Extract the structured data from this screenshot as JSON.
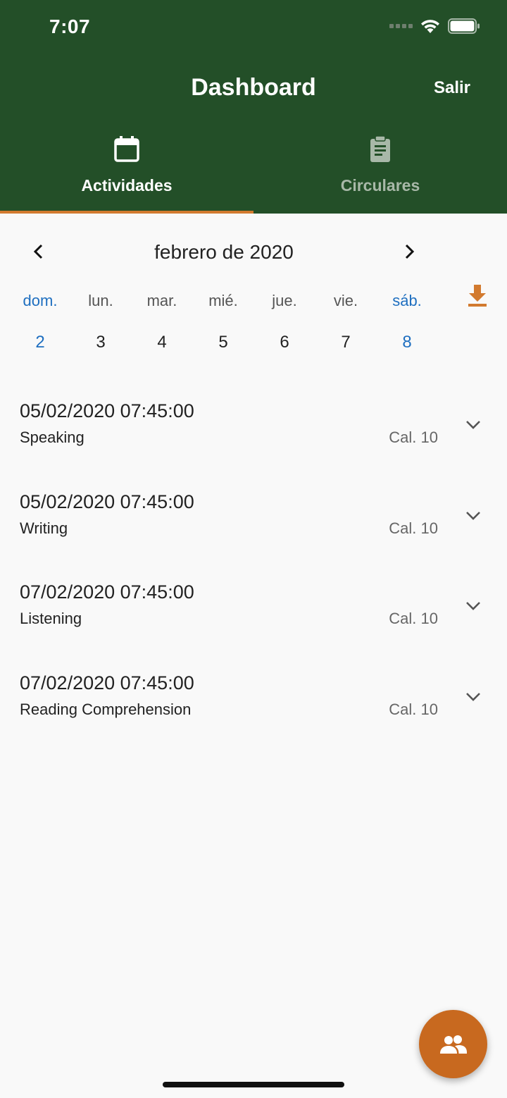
{
  "status_bar": {
    "time": "7:07"
  },
  "header": {
    "title": "Dashboard",
    "exit_label": "Salir"
  },
  "tabs": [
    {
      "label": "Actividades",
      "icon": "calendar-icon",
      "active": true
    },
    {
      "label": "Circulares",
      "icon": "clipboard-icon",
      "active": false
    }
  ],
  "calendar": {
    "month_label": "febrero de 2020",
    "weekdays": [
      "dom.",
      "lun.",
      "mar.",
      "mié.",
      "jue.",
      "vie.",
      "sáb."
    ],
    "dates": [
      "2",
      "3",
      "4",
      "5",
      "6",
      "7",
      "8"
    ]
  },
  "activities": [
    {
      "datetime": "05/02/2020 07:45:00",
      "subject": "Speaking",
      "grade": "Cal. 10"
    },
    {
      "datetime": "05/02/2020 07:45:00",
      "subject": "Writing",
      "grade": "Cal. 10"
    },
    {
      "datetime": "07/02/2020 07:45:00",
      "subject": "Listening",
      "grade": "Cal. 10"
    },
    {
      "datetime": "07/02/2020 07:45:00",
      "subject": "Reading Comprehension",
      "grade": "Cal. 10"
    }
  ],
  "colors": {
    "header_bg": "#234f28",
    "accent": "#d27a2f",
    "fab": "#c8691f",
    "weekend": "#1f6fc0"
  }
}
